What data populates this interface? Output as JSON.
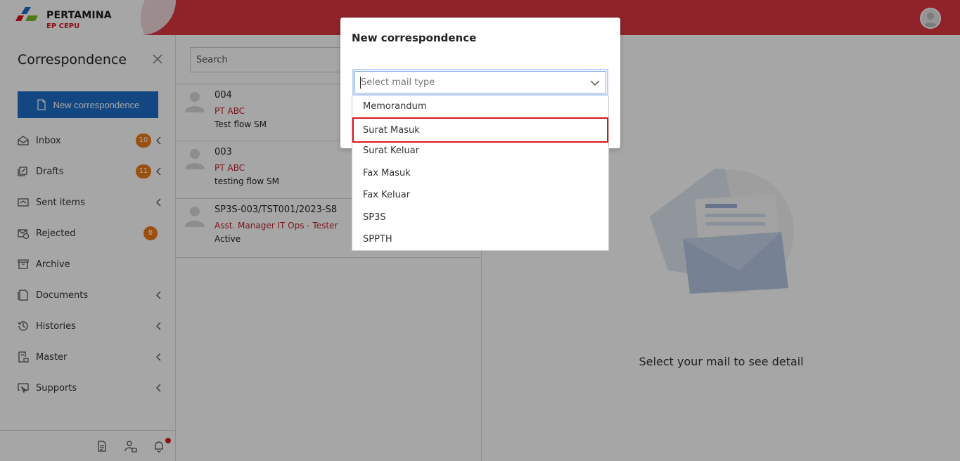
{
  "brand": {
    "name": "PERTAMINA",
    "sub": "EP CEPU"
  },
  "sidebar": {
    "title": "Correspondence",
    "new_button": "New correspondence",
    "items": [
      {
        "label": "Inbox",
        "badge": "10",
        "chevron": true,
        "icon": "inbox-icon"
      },
      {
        "label": "Drafts",
        "badge": "11",
        "chevron": true,
        "icon": "drafts-icon"
      },
      {
        "label": "Sent items",
        "badge": "",
        "chevron": true,
        "icon": "sent-icon"
      },
      {
        "label": "Rejected",
        "badge": "8",
        "chevron": false,
        "icon": "rejected-icon"
      },
      {
        "label": "Archive",
        "badge": "",
        "chevron": false,
        "icon": "archive-icon"
      },
      {
        "label": "Documents",
        "badge": "",
        "chevron": true,
        "icon": "documents-icon"
      },
      {
        "label": "Histories",
        "badge": "",
        "chevron": true,
        "icon": "history-icon"
      },
      {
        "label": "Master",
        "badge": "",
        "chevron": true,
        "icon": "master-icon"
      },
      {
        "label": "Supports",
        "badge": "",
        "chevron": true,
        "icon": "supports-icon"
      }
    ]
  },
  "list": {
    "search_placeholder": "Search",
    "mails": [
      {
        "subject": "004",
        "sender": "PT ABC",
        "preview": "Test flow SM"
      },
      {
        "subject": "003",
        "sender": "PT ABC",
        "preview": "testing flow SM"
      },
      {
        "subject": "SP3S-003/TST001/2023-S8",
        "sender": "Asst. Manager IT Ops - Tester",
        "preview": "Active"
      }
    ]
  },
  "detail": {
    "empty_text": "Select your mail to see detail"
  },
  "modal": {
    "title": "New correspondence",
    "select_placeholder": "Select mail type",
    "options": [
      "Memorandum",
      "Surat Masuk",
      "Surat Keluar",
      "Fax Masuk",
      "Fax Keluar",
      "SP3S",
      "SPPTH"
    ],
    "highlighted": "Surat Masuk"
  },
  "colors": {
    "topbar": "#de3741",
    "primary": "#1e6ec8",
    "badge": "#ee7b1a",
    "sender": "#c0232a",
    "highlight": "#e0121b"
  }
}
